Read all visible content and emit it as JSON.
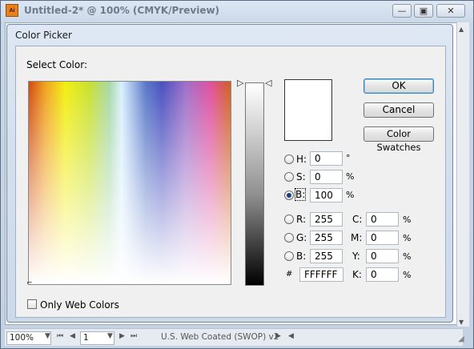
{
  "app": {
    "title": "Untitled-2* @ 100% (CMYK/Preview)",
    "icon_text": "Ai",
    "window_buttons": {
      "minimize": "—",
      "maximize": "▣",
      "close": "✕"
    }
  },
  "dialog": {
    "title": "Color Picker",
    "select_label": "Select Color:",
    "preview_color": "#ffffff",
    "buttons": {
      "ok": "OK",
      "cancel": "Cancel",
      "swatches": "Color Swatches"
    },
    "hsb": [
      {
        "label": "H:",
        "value": "0",
        "unit": "°",
        "checked": false
      },
      {
        "label": "S:",
        "value": "0",
        "unit": "%",
        "checked": false
      },
      {
        "label": "B:",
        "value": "100",
        "unit": "%",
        "checked": true
      }
    ],
    "rgb": [
      {
        "label": "R:",
        "value": "255"
      },
      {
        "label": "G:",
        "value": "255"
      },
      {
        "label": "B:",
        "value": "255"
      }
    ],
    "cmyk": [
      {
        "label": "C:",
        "value": "0",
        "unit": "%"
      },
      {
        "label": "M:",
        "value": "0",
        "unit": "%"
      },
      {
        "label": "Y:",
        "value": "0",
        "unit": "%"
      },
      {
        "label": "K:",
        "value": "0",
        "unit": "%"
      }
    ],
    "hex": {
      "label": "#",
      "value": "FFFFFF"
    },
    "web_colors": {
      "label": "Only Web Colors",
      "checked": false
    }
  },
  "status_bar": {
    "zoom": "100%",
    "page": "1",
    "profile": "U.S. Web Coated (SWOP) v2"
  }
}
